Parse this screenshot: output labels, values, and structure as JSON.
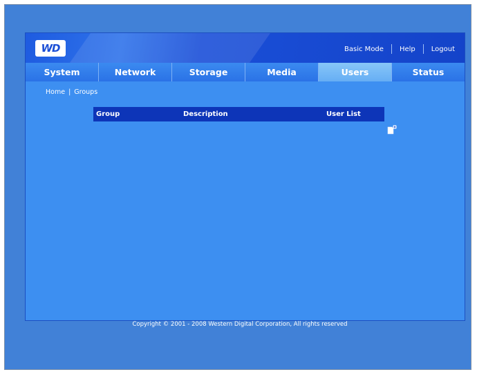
{
  "logo": {
    "text": "WD"
  },
  "header": {
    "links": [
      "Basic Mode",
      "Help",
      "Logout"
    ]
  },
  "tabs": [
    {
      "label": "System"
    },
    {
      "label": "Network"
    },
    {
      "label": "Storage"
    },
    {
      "label": "Media"
    },
    {
      "label": "Users",
      "active": true
    },
    {
      "label": "Status"
    }
  ],
  "breadcrumb": {
    "home": "Home",
    "current": "Groups",
    "separator": "|"
  },
  "table": {
    "columns": [
      "Group",
      "Description",
      "User List"
    ]
  },
  "icons": {
    "add_group": "add-document-icon"
  },
  "footer": {
    "copyright": "Copyright © 2001 - 2008 Western Digital Corporation, All rights reserved"
  },
  "colors": {
    "background": "#4181d7",
    "panel": "#3d8ff1",
    "header": "#1443c9",
    "active_tab": "#66aef4",
    "table_header": "#0d35b8"
  }
}
